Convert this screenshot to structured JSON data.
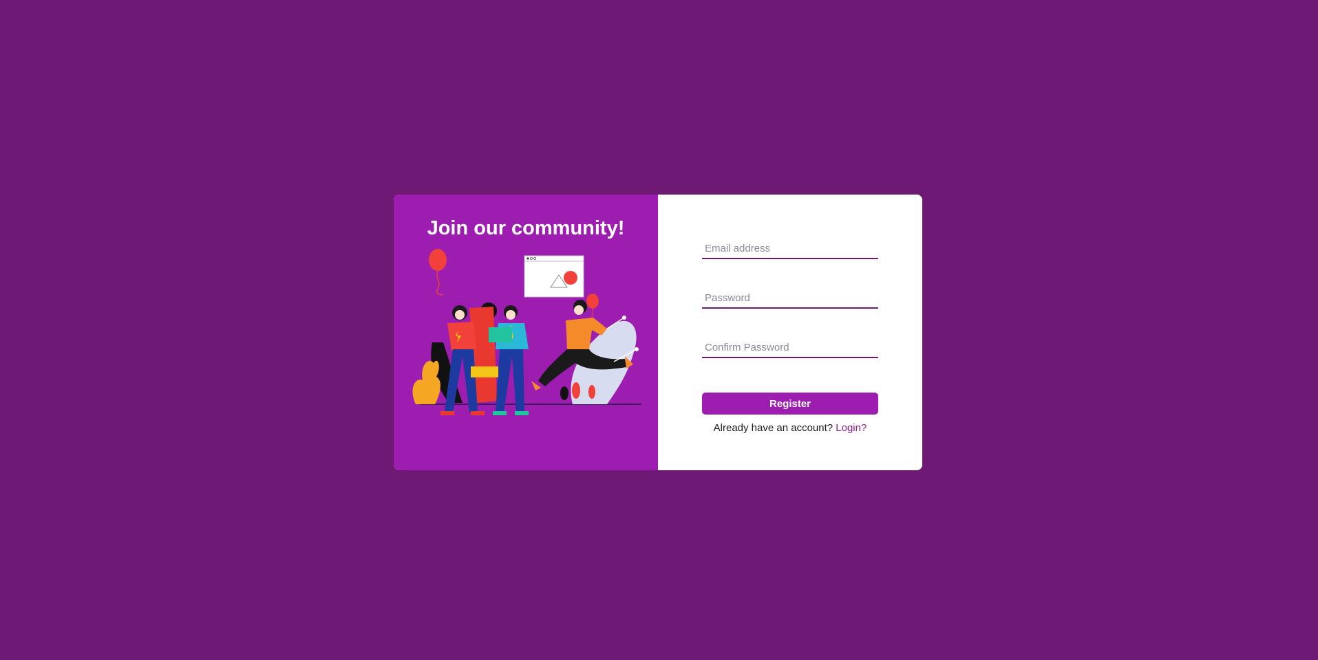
{
  "hero": {
    "title": "Join our community!",
    "illustration": "people-celebrating-illustration"
  },
  "form": {
    "email_placeholder": "Email address",
    "password_placeholder": "Password",
    "confirm_password_placeholder": "Confirm Password",
    "register_label": "Register",
    "login_prompt": "Already have an account?",
    "login_link": "Login?"
  },
  "colors": {
    "background": "#6e1a74",
    "panel": "#9d1db0",
    "accent": "#9d1db0",
    "link": "#8a1a96"
  }
}
